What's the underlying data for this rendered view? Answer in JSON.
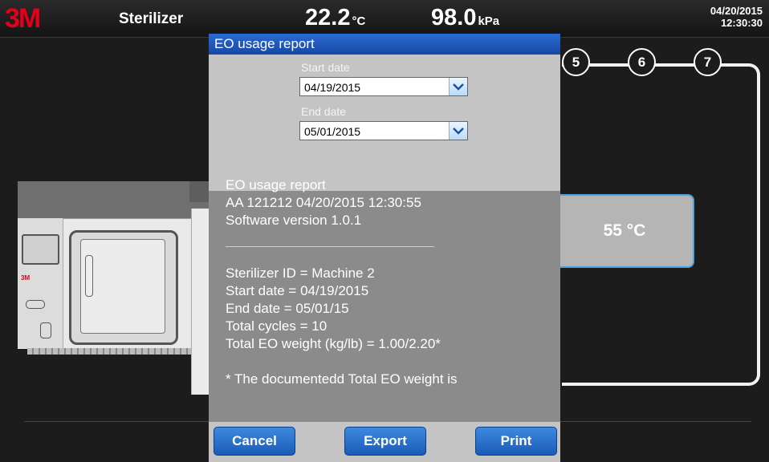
{
  "header": {
    "logo": "3M",
    "title": "Sterilizer",
    "temperature_value": "22.2",
    "temperature_unit": "°C",
    "pressure_value": "98.0",
    "pressure_unit": "kPa",
    "date": "04/20/2015",
    "time": "12:30:30"
  },
  "process": {
    "steps": [
      "5",
      "6",
      "7"
    ],
    "chamber_temperature": "55 °C"
  },
  "machine": {
    "logo": "3M"
  },
  "dialog": {
    "title": "EO usage report",
    "start_date_label": "Start date",
    "start_date_value": "04/19/2015",
    "end_date_label": "End date",
    "end_date_value": "05/01/2015",
    "report_lines_1": [
      "EO usage report",
      "AA 121212 04/20/2015 12:30:55",
      "Software version 1.0.1"
    ],
    "report_lines_2": [
      "Sterilizer ID = Machine 2",
      "Start date = 04/19/2015",
      "End date = 05/01/15",
      "Total cycles = 10",
      "Total EO weight (kg/lb) = 1.00/2.20*"
    ],
    "footnote": "* The documentedd Total EO weight is",
    "buttons": {
      "cancel": "Cancel",
      "export": "Export",
      "print": "Print"
    }
  },
  "colors": {
    "logo_red": "#e2001a",
    "title_blue": "#1f5cc0",
    "button_blue": "#2a72cc",
    "accent_blue": "#4aa3df"
  }
}
